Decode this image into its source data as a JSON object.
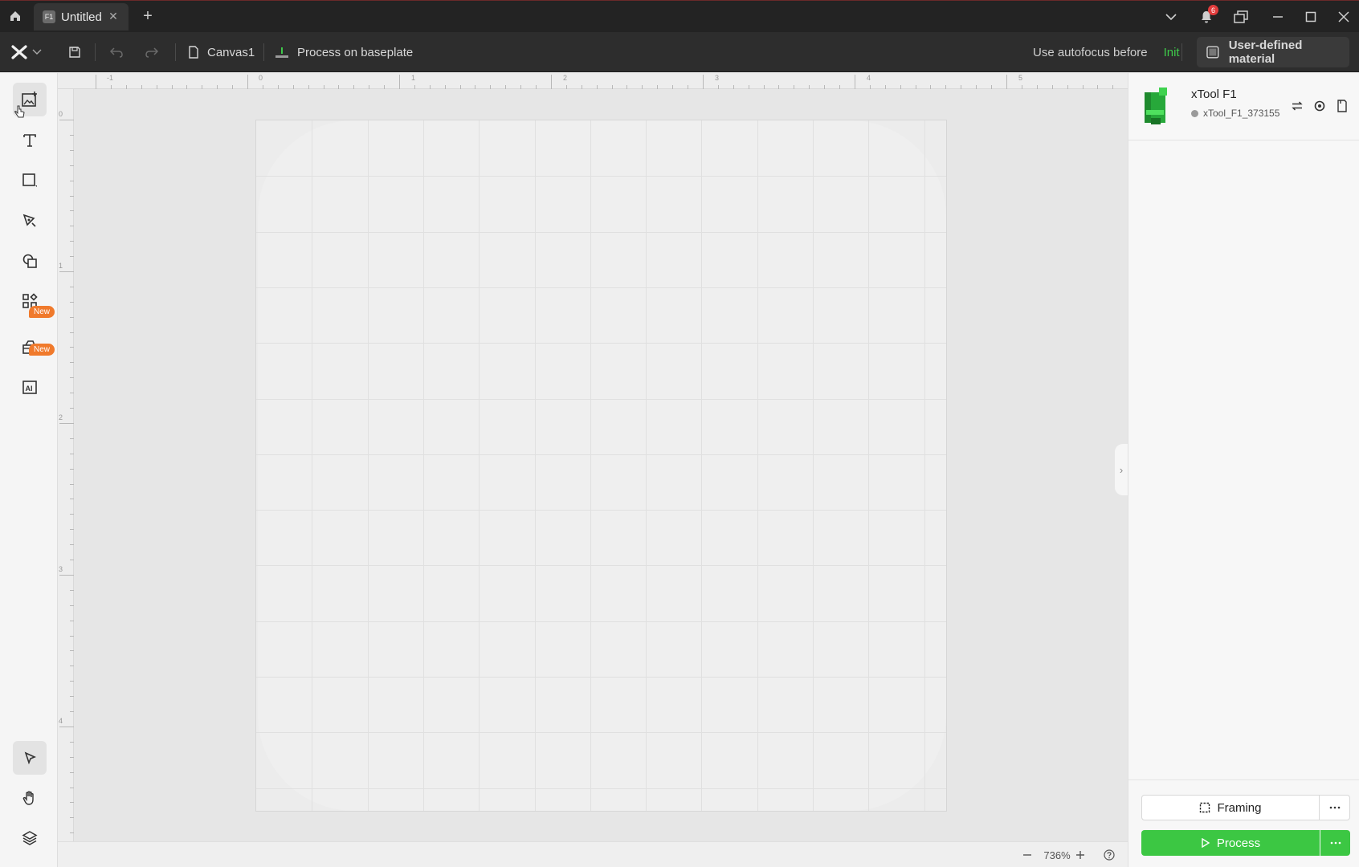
{
  "titlebar": {
    "tab_badge": "F1",
    "tab_title": "Untitled",
    "notification_count": "6"
  },
  "toolbar": {
    "canvas_name": "Canvas1",
    "process_mode": "Process on baseplate",
    "autofocus_label": "Use autofocus before",
    "autofocus_value": "Init",
    "material": "User-defined material"
  },
  "leftbar": {
    "new_badge_1": "New",
    "new_badge_2": "New"
  },
  "ruler": {
    "top_labels": [
      "-1",
      "0",
      "1",
      "2",
      "3",
      "4",
      "5"
    ],
    "left_labels": [
      "0",
      "1",
      "2",
      "3",
      "4"
    ]
  },
  "device": {
    "name": "xTool F1",
    "id": "xTool_F1_373155"
  },
  "actions": {
    "framing": "Framing",
    "process": "Process"
  },
  "zoom": {
    "level": "736%"
  }
}
